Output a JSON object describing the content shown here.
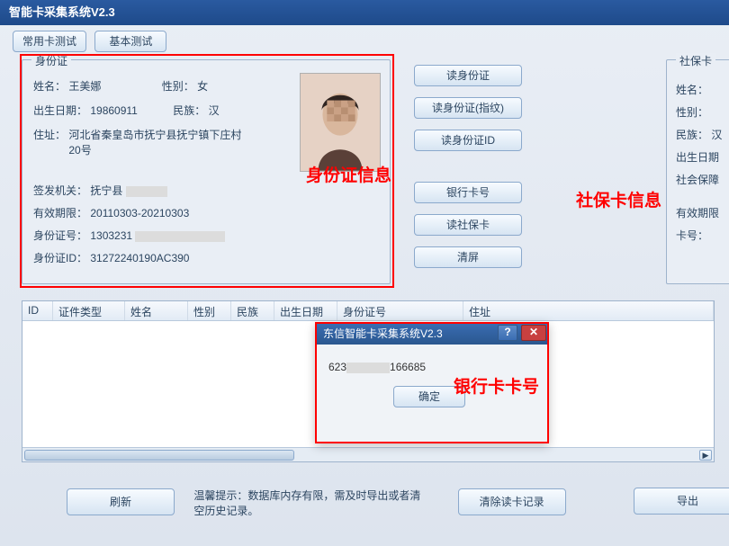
{
  "window": {
    "title": "智能卡采集系统V2.3"
  },
  "toolbar": {
    "common_test": "常用卡测试",
    "basic_test": "基本测试"
  },
  "id_group": {
    "legend": "身份证",
    "name_label": "姓名：",
    "name": "王美娜",
    "gender_label": "性别：",
    "gender": "女",
    "dob_label": "出生日期：",
    "dob": "19860911",
    "ethnic_label": "民族：",
    "ethnic": "汉",
    "addr_label": "住址：",
    "addr": "河北省秦皇岛市抚宁县抚宁镇下庄村20号",
    "issuer_label": "签发机关：",
    "issuer": "抚宁县",
    "valid_label": "有效期限：",
    "valid": "20110303-20210303",
    "idno_label": "身份证号：",
    "idno_prefix": "1303231",
    "cardid_label": "身份证ID：",
    "cardid": "31272240190AC390"
  },
  "actions": {
    "read_id": "读身份证",
    "read_id_fp": "读身份证(指纹)",
    "read_id_id": "读身份证ID",
    "bank_no": "银行卡号",
    "read_social": "读社保卡",
    "clear": "清屏"
  },
  "social_group": {
    "legend": "社保卡",
    "name_label": "姓名：",
    "gender_label": "性别：",
    "ethnic_label": "民族：",
    "ethnic": "汉",
    "dob_label": "出生日期",
    "ssn_label": "社会保障",
    "valid_label": "有效期限",
    "cardno_label": "卡号："
  },
  "annotations": {
    "id_info": "身份证信息",
    "social_info": "社保卡信息",
    "bank_no": "银行卡卡号"
  },
  "table": {
    "columns": [
      "ID",
      "证件类型",
      "姓名",
      "性别",
      "民族",
      "出生日期",
      "身份证号",
      "住址"
    ]
  },
  "dialog": {
    "title": "东信智能卡采集系统V2.3",
    "content_prefix": "623",
    "content_suffix": "166685",
    "ok": "确定"
  },
  "bottom": {
    "refresh": "刷新",
    "tip_label": "温馨提示：",
    "tip_text": "数据库内存有限，需及时导出或者清空历史记录。",
    "clear_records": "清除读卡记录",
    "export": "导出"
  }
}
